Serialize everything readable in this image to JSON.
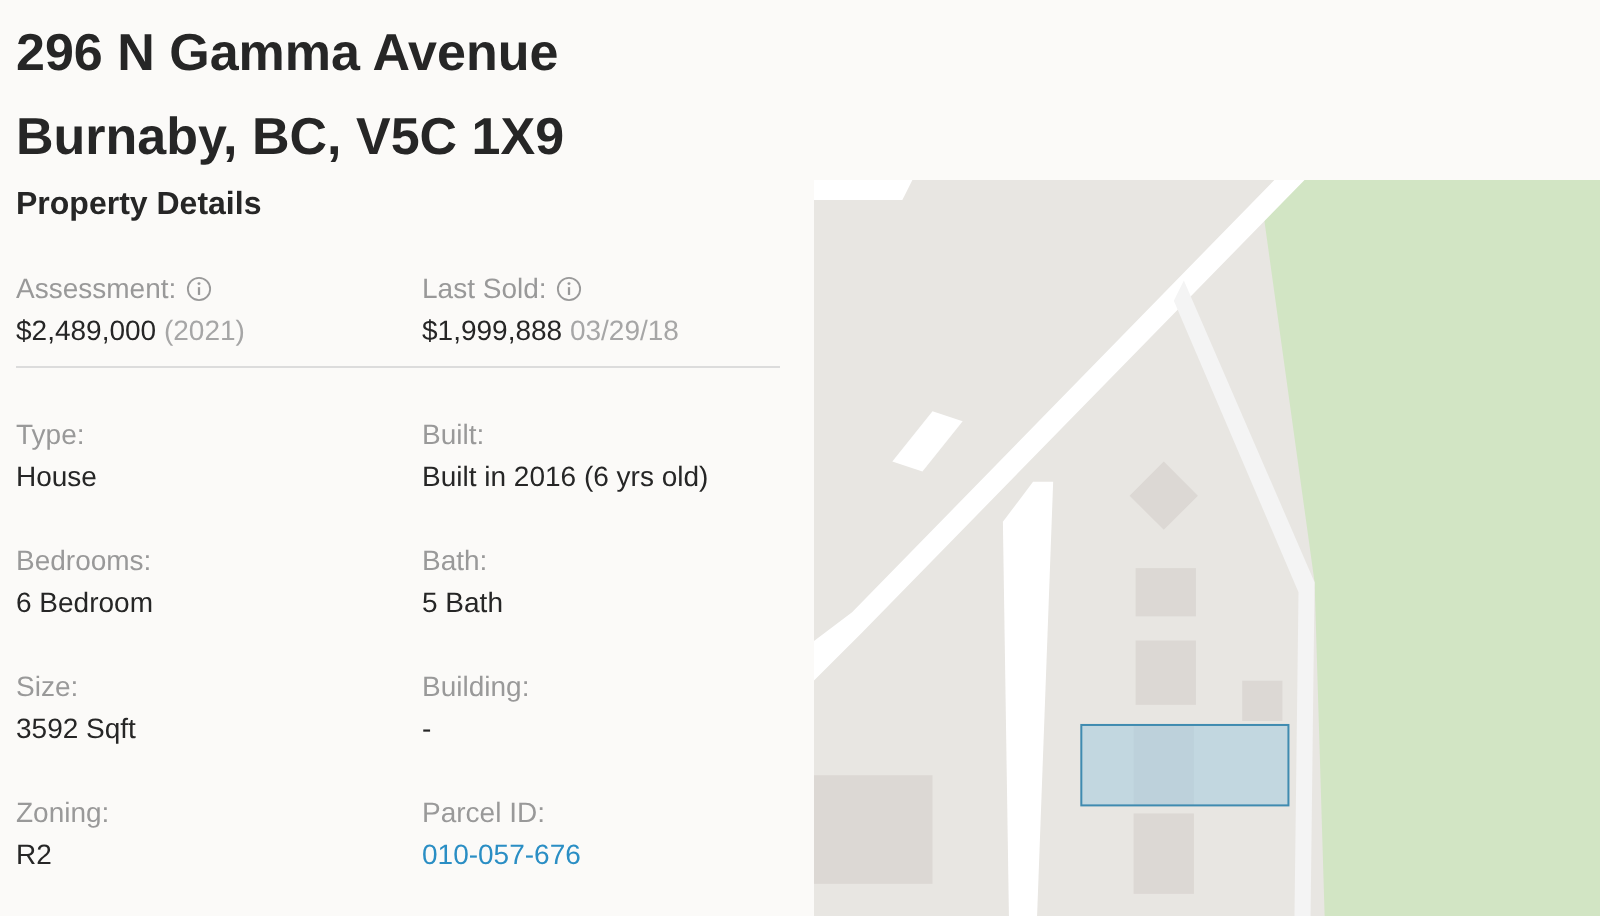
{
  "title_lines": [
    "296 N Gamma Avenue",
    "Burnaby, BC, V5C 1X9"
  ],
  "section_title": "Property Details",
  "summary": [
    {
      "label": "Assessment:",
      "info": true,
      "value": "$2,489,000",
      "note": "(2021)"
    },
    {
      "label": "Last Sold:",
      "info": true,
      "value": "$1,999,888",
      "note": "03/29/18"
    }
  ],
  "details": [
    {
      "label": "Type:",
      "value": "House",
      "kind": "text"
    },
    {
      "label": "Built:",
      "value": "Built in 2016 (6 yrs old)",
      "kind": "text"
    },
    {
      "label": "Bedrooms:",
      "value": "6 Bedroom",
      "kind": "text"
    },
    {
      "label": "Bath:",
      "value": "5 Bath",
      "kind": "text"
    },
    {
      "label": "Size:",
      "value": "3592 Sqft",
      "kind": "text"
    },
    {
      "label": "Building:",
      "value": "-",
      "kind": "text"
    },
    {
      "label": "Zoning:",
      "value": "R2",
      "kind": "text"
    },
    {
      "label": "Parcel ID:",
      "value": "010-057-676",
      "kind": "link"
    }
  ]
}
